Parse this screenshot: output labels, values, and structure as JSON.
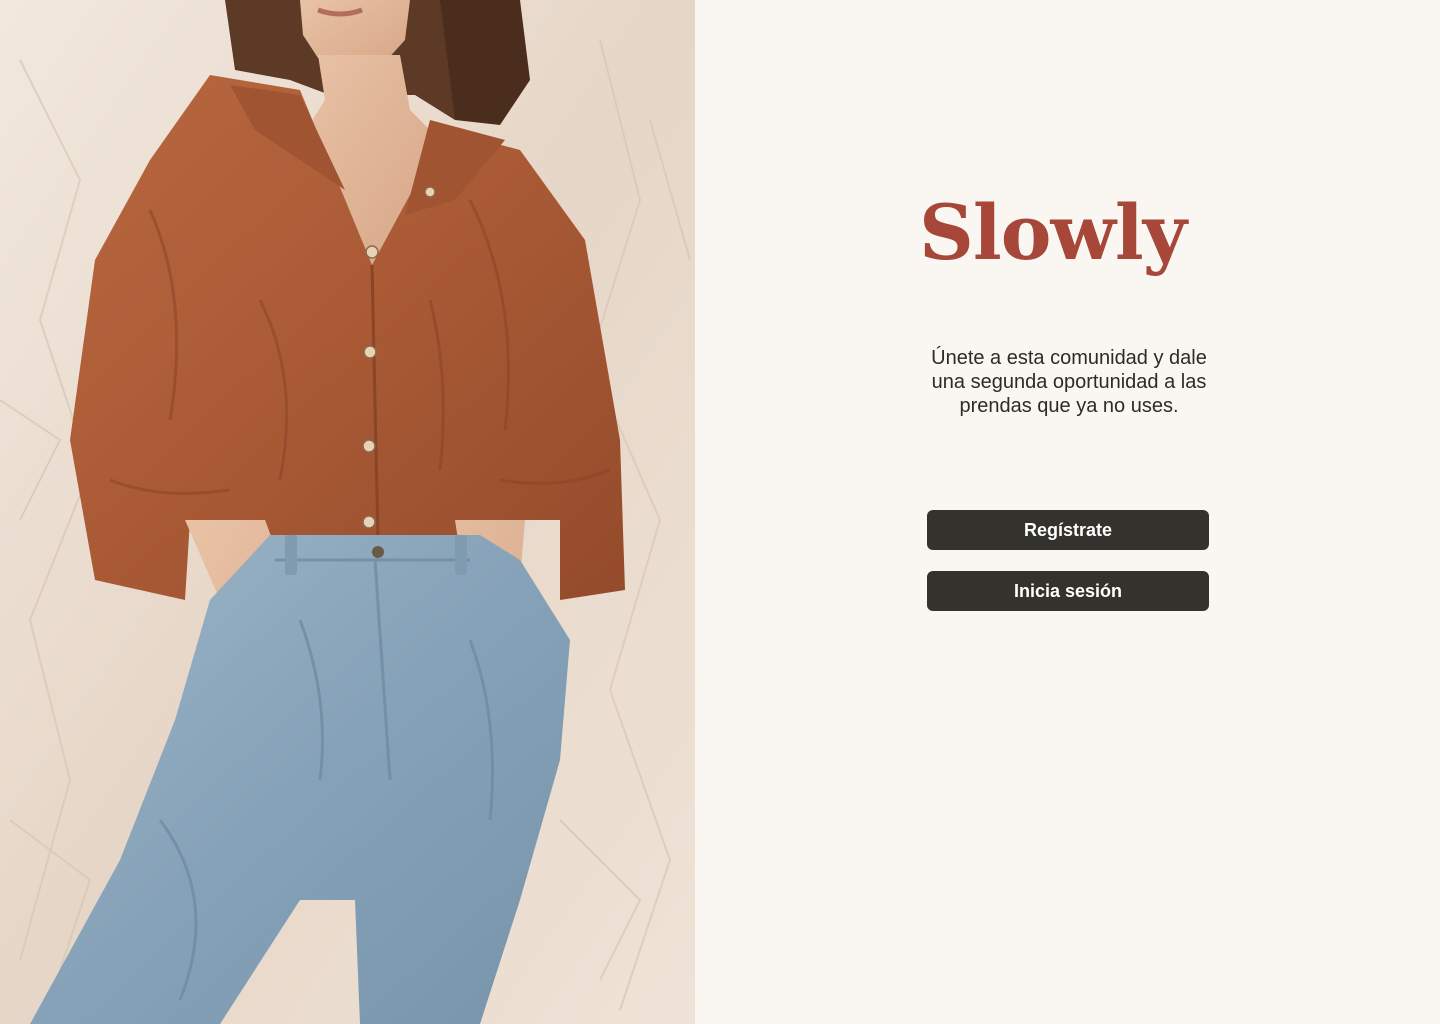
{
  "app": {
    "brand": "Slowly",
    "tagline": "Únete a esta comunidad y dale una segunda oportunidad a las prendas que ya no uses."
  },
  "actions": {
    "register_label": "Regístrate",
    "login_label": "Inicia sesión"
  },
  "hero_image": {
    "subject": "woman-in-rust-linen-shirt-and-jeans"
  },
  "colors": {
    "brand": "#a6473a",
    "button_bg": "#34322d",
    "button_text": "#ffffff",
    "background": "#faf6f2",
    "text": "#2d2b28"
  }
}
